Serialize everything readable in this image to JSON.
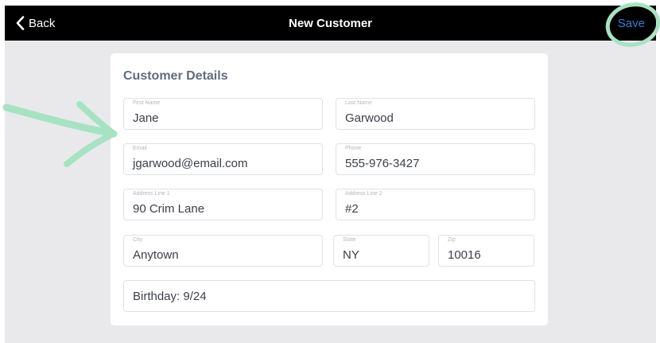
{
  "nav": {
    "back_label": "Back",
    "title": "New Customer",
    "save_label": "Save"
  },
  "card": {
    "title": "Customer Details",
    "fields": {
      "first_name": {
        "label": "First Name",
        "value": "Jane"
      },
      "last_name": {
        "label": "Last Name",
        "value": "Garwood"
      },
      "email": {
        "label": "Email",
        "value": "jgarwood@email.com"
      },
      "phone": {
        "label": "Phone",
        "value": "555-976-3427"
      },
      "address1": {
        "label": "Address Line 1",
        "value": "90 Crim Lane"
      },
      "address2": {
        "label": "Address Line 2",
        "value": "#2"
      },
      "city": {
        "label": "City",
        "value": "Anytown"
      },
      "state": {
        "label": "State",
        "value": "NY"
      },
      "zip": {
        "label": "Zip",
        "value": "10016"
      },
      "notes": {
        "value": "Birthday: 9/24"
      }
    }
  },
  "colors": {
    "nav_bg": "#000000",
    "accent": "#2f7fd8",
    "annotation": "#a6e3c3",
    "page_bg": "#e9e9ec"
  },
  "icons": {
    "back": "chevron-left-icon"
  }
}
